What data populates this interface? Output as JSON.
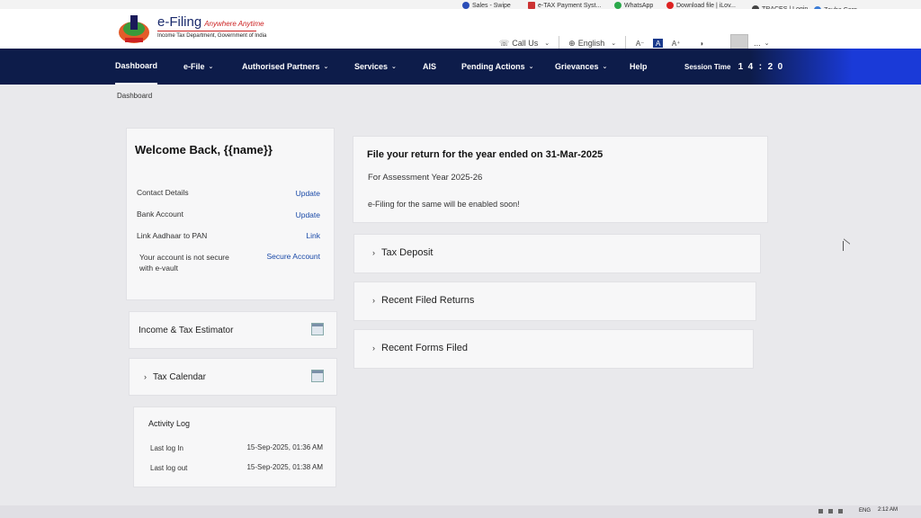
{
  "bookmarks": [
    {
      "label": "Sales - Swipe",
      "icon": "swipe-icon"
    },
    {
      "label": "e-TAX Payment Syst...",
      "icon": "tax-icon"
    },
    {
      "label": "WhatsApp",
      "icon": "whatsapp-icon"
    },
    {
      "label": "Download file | iLov...",
      "icon": "ilovepdf-icon"
    },
    {
      "label": "TRACES | Login",
      "icon": "globe-icon"
    },
    {
      "label": "Zauba Corp",
      "icon": "zauba-icon"
    }
  ],
  "bookmarks_more": "»",
  "brand": {
    "title": "e-Filing",
    "tagline": "Anywhere Anytime",
    "subtitle": "Income Tax Department, Government of India"
  },
  "header": {
    "call_us": "Call Us",
    "language": "English",
    "font_decrease": "A⁻",
    "font_normal": "A",
    "font_increase": "A⁺",
    "contrast": "◑",
    "user_menu": "..."
  },
  "nav": {
    "items": [
      {
        "label": "Dashboard",
        "caret": ""
      },
      {
        "label": "e-File",
        "caret": "⌄"
      },
      {
        "label": "Authorised Partners",
        "caret": "⌄"
      },
      {
        "label": "Services",
        "caret": "⌄"
      },
      {
        "label": "AIS",
        "caret": ""
      },
      {
        "label": "Pending Actions",
        "caret": "⌄"
      },
      {
        "label": "Grievances",
        "caret": "⌄"
      },
      {
        "label": "Help",
        "caret": ""
      }
    ],
    "session_label": "Session Time",
    "session_digits": [
      "1",
      "4",
      ":",
      "2",
      "0"
    ]
  },
  "breadcrumb": "Dashboard",
  "welcome": {
    "title": "Welcome Back, {{name}}",
    "rows": [
      {
        "label": "Contact Details",
        "action": "Update"
      },
      {
        "label": "Bank Account",
        "action": "Update"
      },
      {
        "label": "Link Aadhaar to PAN",
        "action": "Link"
      },
      {
        "label": "Your account is not secure with e-vault",
        "action": "Secure Account"
      }
    ]
  },
  "tools": {
    "estimator": "Income & Tax Estimator",
    "calendar": "Tax Calendar"
  },
  "activity": {
    "title": "Activity Log",
    "rows": [
      {
        "label": "Last log In",
        "value": "15-Sep-2025, 01:36 AM"
      },
      {
        "label": "Last log out",
        "value": "15-Sep-2025, 01:38 AM"
      }
    ]
  },
  "filing": {
    "title": "File your return for the year ended on 31-Mar-2025",
    "assessment_year": "For Assessment Year 2025-26",
    "notice": "e-Filing for the same will be enabled soon!"
  },
  "accordions": [
    "Tax Deposit",
    "Recent Filed Returns",
    "Recent Forms Filed"
  ],
  "taskbar": {
    "lang": "ENG",
    "time": "2:12 AM"
  },
  "colors": {
    "nav_bg": "#0d1c4a",
    "nav_accent": "#1a3ad8",
    "link": "#1a4aa8",
    "brand_red": "#cc2222"
  }
}
